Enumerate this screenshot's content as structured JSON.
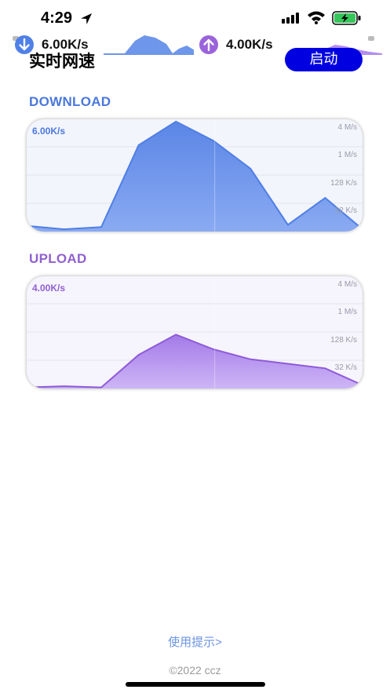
{
  "status_bar": {
    "time": "4:29"
  },
  "floating_window": {
    "download_speed": "6.00K/s",
    "upload_speed": "4.00K/s"
  },
  "header": {
    "title": "实时网速",
    "start_button": "启动"
  },
  "download": {
    "label": "DOWNLOAD",
    "current": "6.00K/s",
    "ticks": [
      "4 M/s",
      "1 M/s",
      "128 K/s",
      "32 K/s"
    ],
    "color": "#4f80e6"
  },
  "upload": {
    "label": "UPLOAD",
    "current": "4.00K/s",
    "ticks": [
      "4 M/s",
      "1 M/s",
      "128 K/s",
      "32 K/s"
    ],
    "color": "#9a63dc"
  },
  "chart_data": [
    {
      "type": "area",
      "series": [
        {
          "values": [
            0.05,
            0.02,
            0.04,
            0.77,
            0.98,
            0.81,
            0.56,
            0.06,
            0.3,
            0.02
          ]
        }
      ],
      "y_tick_labels": [
        "4 M/s",
        "1 M/s",
        "128 K/s",
        "32 K/s"
      ],
      "ylim": [
        0,
        1
      ]
    },
    {
      "type": "area",
      "series": [
        {
          "values": [
            0.01,
            0.02,
            0.01,
            0.3,
            0.48,
            0.35,
            0.26,
            0.22,
            0.18,
            0.03
          ]
        }
      ],
      "y_tick_labels": [
        "4 M/s",
        "1 M/s",
        "128 K/s",
        "32 K/s"
      ],
      "ylim": [
        0,
        1
      ]
    }
  ],
  "footer": {
    "tips_link": "使用提示>",
    "copyright": "©2022 ccz"
  }
}
